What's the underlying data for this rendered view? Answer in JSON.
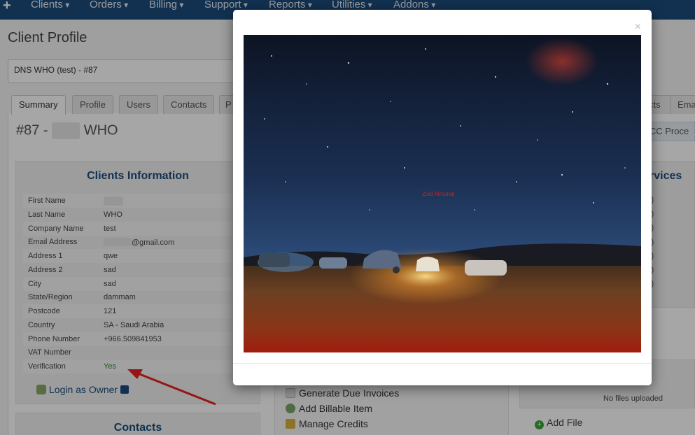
{
  "nav": {
    "plus_icon": "+",
    "items": [
      "Clients",
      "Orders",
      "Billing",
      "Support",
      "Reports",
      "Utilities",
      "Addons"
    ]
  },
  "page_title": "Client Profile",
  "client_select": {
    "value": "DNS WHO (test) - #87"
  },
  "tabs": [
    "Summary",
    "Profile",
    "Users",
    "Contacts",
    "P",
    "cts",
    "Ema"
  ],
  "client_heading": {
    "prefix": "#87 -",
    "suffix": "WHO"
  },
  "clients_information": {
    "title": "Clients Information",
    "rows": [
      {
        "label": "First Name",
        "value": ""
      },
      {
        "label": "Last Name",
        "value": "WHO"
      },
      {
        "label": "Company Name",
        "value": "test"
      },
      {
        "label": "Email Address",
        "value": "@gmail.com"
      },
      {
        "label": "Address 1",
        "value": "qwe"
      },
      {
        "label": "Address 2",
        "value": "sad"
      },
      {
        "label": "City",
        "value": "sad"
      },
      {
        "label": "State/Region",
        "value": "dammam"
      },
      {
        "label": "Postcode",
        "value": "121"
      },
      {
        "label": "Country",
        "value": "SA - Saudi Arabia"
      },
      {
        "label": "Phone Number",
        "value": "+966.509841953"
      },
      {
        "label": "VAT Number",
        "value": ""
      },
      {
        "label": "Verification",
        "value": "Yes"
      }
    ],
    "login_as_owner": "Login as Owner"
  },
  "contacts_title": "Contacts",
  "actions": [
    "Generate Due Invoices",
    "Add Billable Item",
    "Manage Credits"
  ],
  "right": {
    "cc_button": "o CC Proce",
    "services_title": "rvices",
    "files_empty": "No files uploaded",
    "add_file": "Add File",
    "service_partials": [
      "l)",
      "l)",
      "l)",
      "l)",
      "l)",
      "l)",
      "l)"
    ]
  },
  "modal": {
    "close_icon": "×",
    "watermark": "Zaid Almahdi"
  }
}
